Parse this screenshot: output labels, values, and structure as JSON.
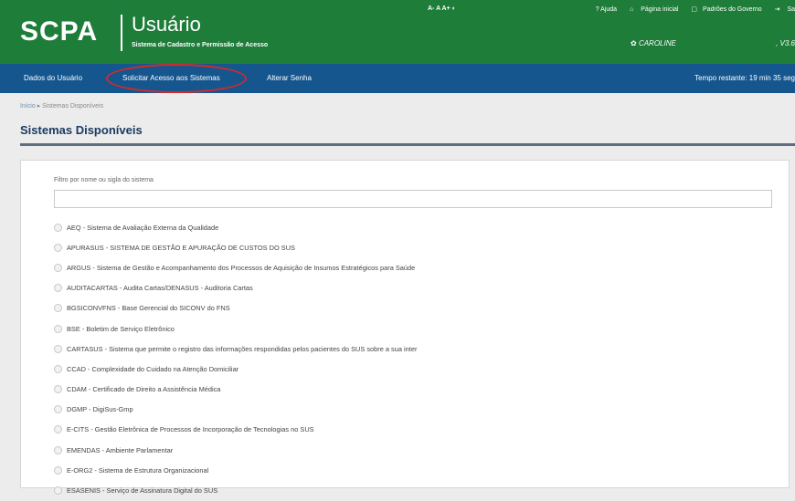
{
  "header": {
    "logo": "SCPA",
    "title": "Usuário",
    "subtitle": "Sistema de Cadastro e Permissão de Acesso",
    "font_controls": "A- A A+ ◐",
    "links": [
      "? Ajuda",
      "Página inicial",
      "Padrões do Governo",
      "Sa"
    ],
    "user": "CAROLINE",
    "version": ", V3.6"
  },
  "nav": {
    "items": [
      "Dados do Usuário",
      "Solicitar Acesso aos Sistemas",
      "Alterar Senha"
    ],
    "timer": "Tempo restante: 19 min 35 seg"
  },
  "breadcrumb": {
    "home": "Início",
    "current": "Sistemas Disponíveis"
  },
  "page_title": "Sistemas Disponíveis",
  "filter": {
    "label": "Filtro por nome ou sigla do sistema",
    "value": ""
  },
  "systems": [
    "AEQ - Sistema de Avaliação Externa da Qualidade",
    "APURASUS - SISTEMA DE GESTÃO E APURAÇÃO DE CUSTOS DO SUS",
    "ARGUS - Sistema de Gestão e Acompanhamento dos Processos de Aquisição de Insumos Estratégicos para Saúde",
    "AUDITACARTAS - Audita Cartas/DENASUS - Auditoria Cartas",
    "BGSICONVFNS - Base Gerencial do SICONV do FNS",
    "BSE - Boletim de Serviço Eletrônico",
    "CARTASUS - Sistema que permite o registro das informações respondidas pelos pacientes do SUS sobre a sua inter",
    "CCAD - Complexidade do Cuidado na Atenção Domiciliar",
    "CDAM - Certificado de Direito a Assistência Médica",
    "DGMP - DigiSus-Gmp",
    "E-CITS - Gestão Eletrônica de Processos de Incorporação de Tecnologias no SUS",
    "EMENDAS - Ambiente Parlamentar",
    "E-ORG2 - Sistema de Estrutura Organizacional",
    "ESASENIS - Serviço de Assinatura Digital do SUS"
  ]
}
